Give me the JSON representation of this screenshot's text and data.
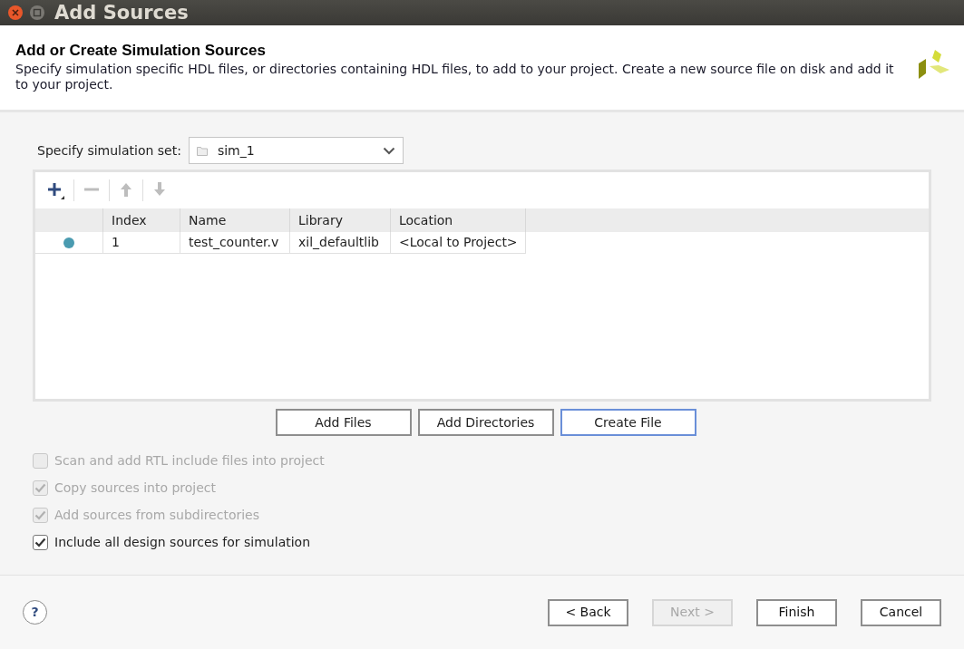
{
  "window": {
    "title": "Add Sources"
  },
  "header": {
    "title": "Add or Create Simulation Sources",
    "description": "Specify simulation specific HDL files, or directories containing HDL files, to add to your project. Create a new source file on disk and add it to your project."
  },
  "simulation_set": {
    "label": "Specify simulation set:",
    "value": "sim_1"
  },
  "toolbar": [
    {
      "kind": "add",
      "disabled": false
    },
    {
      "kind": "remove",
      "disabled": true
    },
    {
      "kind": "up",
      "disabled": true
    },
    {
      "kind": "down",
      "disabled": true
    }
  ],
  "table": {
    "columns": [
      "Index",
      "Name",
      "Library",
      "Location"
    ],
    "rows": [
      {
        "color": "#4a9bb0",
        "cells": [
          "1",
          "test_counter.v",
          "xil_defaultlib",
          "<Local to Project>"
        ]
      }
    ]
  },
  "file_buttons": [
    {
      "label": "Add Files",
      "focused": false
    },
    {
      "label": "Add Directories",
      "focused": false
    },
    {
      "label": "Create File",
      "focused": true
    }
  ],
  "options": [
    {
      "label": "Scan and add RTL include files into project",
      "checked": false,
      "disabled": true
    },
    {
      "label": "Copy sources into project",
      "checked": true,
      "disabled": true
    },
    {
      "label": "Add sources from subdirectories",
      "checked": true,
      "disabled": true
    },
    {
      "label": "Include all design sources for simulation",
      "checked": true,
      "disabled": false
    }
  ],
  "help": "?",
  "footer_buttons": [
    {
      "label": "< Back",
      "disabled": false
    },
    {
      "label": "Next >",
      "disabled": true
    },
    {
      "label": "Finish",
      "disabled": false
    },
    {
      "label": "Cancel",
      "disabled": false
    }
  ]
}
